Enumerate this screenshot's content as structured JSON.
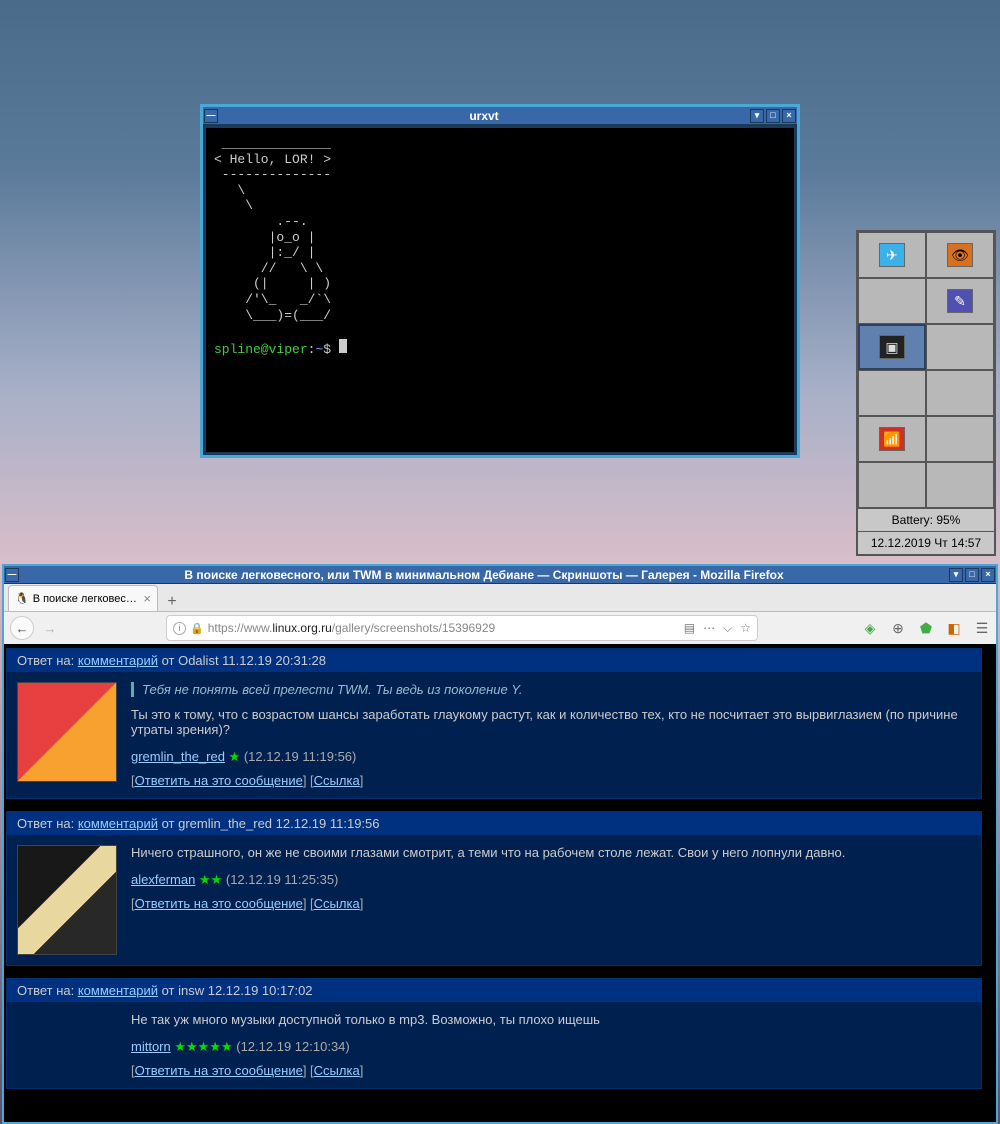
{
  "terminal": {
    "title": "urxvt",
    "banner_top": " ______________",
    "banner_hello": "< Hello, LOR! >",
    "banner_bot": " --------------",
    "cow": "   \\\n    \\\n        .--.\n       |o_o |\n       |:_/ |\n      //   \\ \\\n     (|     | )\n    /'\\_   _/`\\\n    \\___)=(___/",
    "prompt_user": "spline@viper",
    "prompt_sep": ":",
    "prompt_cwd": "~",
    "prompt_char": "$"
  },
  "pager": {
    "battery": "Battery: 95%",
    "datetime": "12.12.2019 Чт 14:57"
  },
  "firefox": {
    "title": "В поиске легковесного, или TWM в минимальном Дебиане — Скриншоты — Галерея - Mozilla Firefox",
    "tab_label": "В поиске легковесного",
    "url_prefix": "https://www.",
    "url_domain": "linux.org.ru",
    "url_path": "/gallery/screenshots/15396929"
  },
  "comments": [
    {
      "reply_prefix": "Ответ на: ",
      "reply_link": "комментарий",
      "reply_meta": " от Odalist 11.12.19 20:31:28",
      "avatar": "av1",
      "quote": "Тебя не понять всей прелести TWM. Ты ведь из поколение Y.",
      "text": "Ты это к тому, что с возрастом шансы заработать глаукому растут, как и количество тех, кто не посчитает это вырвиглазием (по причине утраты зрения)?",
      "user": "gremlin_the_red",
      "stars": "★",
      "date": " (12.12.19 11:19:56)",
      "reply": "Ответить на это сообщение",
      "link": "Ссылка"
    },
    {
      "reply_prefix": "Ответ на: ",
      "reply_link": "комментарий",
      "reply_meta": " от gremlin_the_red 12.12.19 11:19:56",
      "avatar": "av2",
      "quote": "",
      "text": "Ничего страшного, он же не своими глазами смотрит, а теми что на рабочем столе лежат. Свои у него лопнули давно.",
      "user": "alexferman",
      "stars": "★★",
      "date": " (12.12.19 11:25:35)",
      "reply": "Ответить на это сообщение",
      "link": "Ссылка"
    },
    {
      "reply_prefix": "Ответ на: ",
      "reply_link": "комментарий",
      "reply_meta": " от insw 12.12.19 10:17:02",
      "avatar": "",
      "quote": "",
      "text": "Не так уж много музыки доступной только в mp3. Возможно, ты плохо ищешь",
      "user": "mittorn",
      "stars": "★★★★★",
      "date": " (12.12.19 12:10:34)",
      "reply": "Ответить на это сообщение",
      "link": "Ссылка"
    }
  ]
}
